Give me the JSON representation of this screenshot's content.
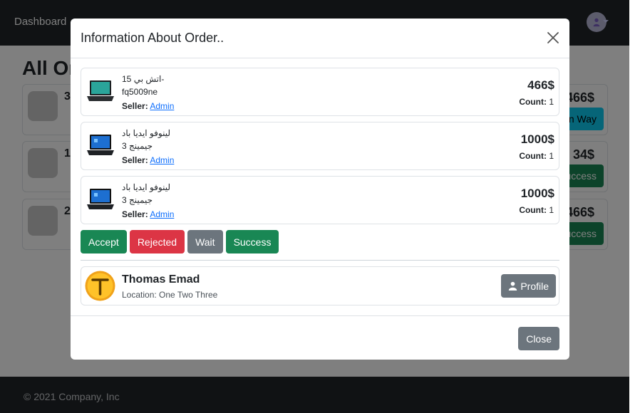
{
  "navbar": {
    "brand": "Dashboard"
  },
  "page": {
    "title": "All Or"
  },
  "orders": [
    {
      "num": "3",
      "price": "466$",
      "status": "On Way"
    },
    {
      "num": "1",
      "price": "34$",
      "status": "Success"
    },
    {
      "num": "2",
      "price": "466$",
      "status": "Success"
    }
  ],
  "footer": {
    "text": "© 2021 Company, Inc"
  },
  "modal": {
    "title": "Information About Order..",
    "items": [
      {
        "name": "15 اتش بي-\nfq5009ne",
        "seller_label": "Seller:",
        "seller": "Admin",
        "price": "466$",
        "count_label": "Count:",
        "count": "1"
      },
      {
        "name": "لينوفو ايديا باد\nجيمينج 3",
        "seller_label": "Seller:",
        "seller": "Admin",
        "price": "1000$",
        "count_label": "Count:",
        "count": "1"
      },
      {
        "name": "لينوفو ايديا باد\nجيمينج 3",
        "seller_label": "Seller:",
        "seller": "Admin",
        "price": "1000$",
        "count_label": "Count:",
        "count": "1"
      }
    ],
    "actions": {
      "accept": "Accept",
      "rejected": "Rejected",
      "wait": "Wait",
      "success": "Success"
    },
    "customer": {
      "name": "Thomas Emad",
      "location": "Location: One Two Three",
      "profile_label": "Profile"
    },
    "close_label": "Close"
  },
  "colors": {
    "success": "#198754",
    "danger": "#dc3545",
    "secondary": "#6c757d",
    "info": "#0dcaf0",
    "dark": "#212529"
  }
}
